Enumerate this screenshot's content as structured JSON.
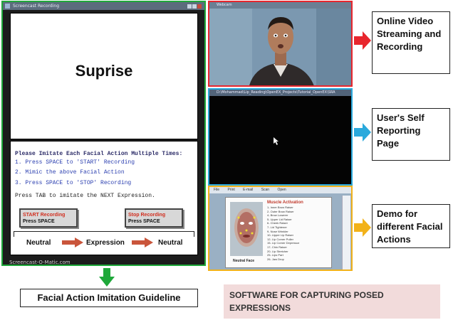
{
  "guideline_window": {
    "title": "Screencast Recording",
    "expression": "Suprise",
    "instructions": {
      "heading": "Please Imitate Each Facial Action Multiple Times:",
      "step_1": "1. Press SPACE to 'START' Recording",
      "step_2": "2. Mimic the above Facial Action",
      "step_3": "3. Press SPACE to 'STOP' Recording",
      "next": "Press TAB to imitate the NEXT Expression."
    },
    "start_button": {
      "line1": "START Recording",
      "line2": "Press SPACE"
    },
    "stop_button": {
      "line1": "Stop Recording",
      "line2": "Press SPACE"
    },
    "flow": [
      "Neutral",
      "Expression",
      "Neutral"
    ],
    "watermark": "Screencast-O-Matic.com",
    "frame_color": "#1fa83a"
  },
  "video_window": {
    "title": "Webcam",
    "frame_color": "#e8262d"
  },
  "report_window": {
    "title": "D:\\Mohammad\\Lip_Reading\\OpenEX_Projects\\Tutorial_OpenEX\\SRA",
    "frame_color": "#2aa9dc"
  },
  "demo_window": {
    "toolbar": [
      "File",
      "Print",
      "E-mail",
      "Scan",
      "Open"
    ],
    "panel_title": "Muscle Activation",
    "muscles": [
      "1- Inner Brow Raiser",
      "2- Outer Brow Raiser",
      "4- Brow Lowerer",
      "5- Upper Lid Raiser",
      "6- Cheek Raiser",
      "7- Lid Tightener",
      "9- Nose Wrinkler",
      "10- Upper Lip Raiser",
      "12- Lip Corner Puller",
      "15- Lip Corner Depressor",
      "17- Chin Raiser",
      "20- Lip Stretcher",
      "25- Lips Part",
      "26- Jaw Drop"
    ],
    "face_caption": "Neutral Face",
    "frame_color": "#f2b21a"
  },
  "callouts": {
    "video": "Online Video Streaming and Recording",
    "report": "User's Self Reporting Page",
    "demo": "Demo for different Facial Actions"
  },
  "captions": {
    "guideline": "Facial Action Imitation Guideline",
    "software": "SOFTWARE FOR CAPTURING POSED EXPRESSIONS"
  },
  "colors": {
    "green": "#1fa83a",
    "red": "#e8262d",
    "blue": "#2aa9dc",
    "orange": "#f2b21a",
    "banner": "#f2dbdb"
  }
}
